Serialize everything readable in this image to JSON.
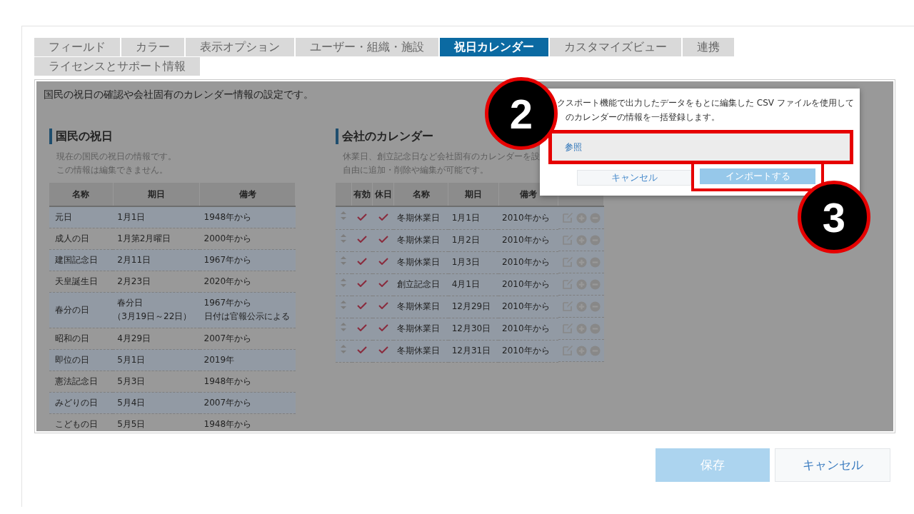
{
  "tabs": [
    {
      "label": "フィールド",
      "selected": false
    },
    {
      "label": "カラー",
      "selected": false
    },
    {
      "label": "表示オプション",
      "selected": false
    },
    {
      "label": "ユーザー・組織・施設",
      "selected": false
    },
    {
      "label": "祝日カレンダー",
      "selected": true
    },
    {
      "label": "カスタマイズビュー",
      "selected": false
    },
    {
      "label": "連携",
      "selected": false
    },
    {
      "label": "ライセンスとサポート情報",
      "selected": false
    }
  ],
  "intro": "国民の祝日の確認や会社固有のカレンダー情報の設定です。",
  "national_holidays": {
    "title": "国民の祝日",
    "description": [
      "現在の国民の祝日の情報です。",
      "この情報は編集できません。"
    ],
    "columns": [
      "名称",
      "期日",
      "備考"
    ],
    "rows": [
      {
        "name": "元日",
        "date": "1月1日",
        "note": "1948年から"
      },
      {
        "name": "成人の日",
        "date": "1月第2月曜日",
        "note": "2000年から"
      },
      {
        "name": "建国記念日",
        "date": "2月11日",
        "note": "1967年から"
      },
      {
        "name": "天皇誕生日",
        "date": "2月23日",
        "note": "2020年から"
      },
      {
        "name": "春分の日",
        "date": [
          "春分日",
          "（3月19日～22日）"
        ],
        "note": [
          "1967年から",
          "日付は官報公示による"
        ]
      },
      {
        "name": "昭和の日",
        "date": "4月29日",
        "note": "2007年から"
      },
      {
        "name": "即位の日",
        "date": "5月1日",
        "note": "2019年"
      },
      {
        "name": "憲法記念日",
        "date": "5月3日",
        "note": "1948年から"
      },
      {
        "name": "みどりの日",
        "date": "5月4日",
        "note": "2007年から"
      },
      {
        "name": "こどもの日",
        "date": "5月5日",
        "note": "1948年から"
      }
    ]
  },
  "company_calendar": {
    "title": "会社のカレンダー",
    "description": [
      "休業日、創立記念日など会社固有のカレンダーを設",
      "自由に追加・削除や編集が可能です。"
    ],
    "columns": [
      "有効",
      "休日",
      "名称",
      "期日",
      "備考"
    ],
    "rows": [
      {
        "enabled": true,
        "holiday": true,
        "name": "冬期休業日",
        "date": "1月1日",
        "note": "2010年から"
      },
      {
        "enabled": true,
        "holiday": true,
        "name": "冬期休業日",
        "date": "1月2日",
        "note": "2010年から"
      },
      {
        "enabled": true,
        "holiday": true,
        "name": "冬期休業日",
        "date": "1月3日",
        "note": "2010年から"
      },
      {
        "enabled": true,
        "holiday": true,
        "name": "創立記念日",
        "date": "4月1日",
        "note": "2010年から"
      },
      {
        "enabled": true,
        "holiday": true,
        "name": "冬期休業日",
        "date": "12月29日",
        "note": "2010年から"
      },
      {
        "enabled": true,
        "holiday": true,
        "name": "冬期休業日",
        "date": "12月30日",
        "note": "2010年から"
      },
      {
        "enabled": true,
        "holiday": true,
        "name": "冬期休業日",
        "date": "12月31日",
        "note": "2010年から"
      }
    ]
  },
  "import_dialog": {
    "text": [
      "クスポート機能で出力したデータをもとに編集した CSV ファイルを使用して",
      "のカレンダーの情報を一括登録します。"
    ],
    "browse": "参照",
    "cancel": "キャンセル",
    "import": "インポートする"
  },
  "callouts": [
    {
      "label": "2"
    },
    {
      "label": "3"
    }
  ],
  "footer": {
    "save": "保存",
    "cancel": "キャンセル"
  }
}
